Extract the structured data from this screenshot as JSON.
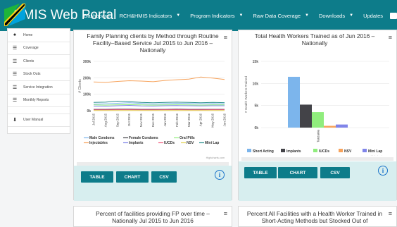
{
  "brand": {
    "title": "HMIS Web Portal"
  },
  "nav": {
    "items": [
      "Dashboard",
      "RCH&HMIS Indicators",
      "Program Indicators",
      "Raw Data Coverage",
      "Downloads",
      "Updates"
    ]
  },
  "sidebar": {
    "items": [
      {
        "label": "Home",
        "icon": "home-icon"
      },
      {
        "label": "Coverage",
        "icon": "list-icon"
      },
      {
        "label": "Clients",
        "icon": "list-icon"
      },
      {
        "label": "Stock Outs",
        "icon": "list-icon"
      },
      {
        "label": "Service Integration",
        "icon": "list-icon"
      },
      {
        "label": "Monthly Reports",
        "icon": "list-icon"
      },
      {
        "label": "User Manual",
        "icon": "download-icon"
      }
    ]
  },
  "buttons": {
    "table": "TABLE",
    "chart": "CHART",
    "csv": "CSV"
  },
  "credit": "Highcharts.com",
  "panels": {
    "p3_title": "Percent of facilities providing FP over time – Nationally Jul 2015 to Jun 2016",
    "p4_title": "Percent All Facilities with a Health Worker Trained in Short-Acting Methods but Stocked Out of"
  },
  "chart_data": [
    {
      "type": "line",
      "title": "Family Planning clients by Method through Routine Facility–Based Service Jul 2015 to Jun 2016 – Nationally",
      "ylabel": "# Clients",
      "ylim": [
        0,
        300000
      ],
      "yticks": [
        "300k",
        "200k",
        "100k",
        "0k"
      ],
      "x": [
        "Jul 2015",
        "Aug 2015",
        "Sep 2015",
        "Oct 2015",
        "Nov 2015",
        "Dec 2015",
        "Jan 2016",
        "Feb 2016",
        "Mar 2016",
        "Apr 2016",
        "May 2016",
        "Jun 2016"
      ],
      "series": [
        {
          "name": "Male Condoms",
          "color": "#7cb5ec",
          "values": [
            40000,
            42000,
            45000,
            48000,
            44000,
            40000,
            43000,
            45000,
            44000,
            42000,
            43000,
            42000
          ]
        },
        {
          "name": "Female Condoms",
          "color": "#434348",
          "values": [
            8000,
            8000,
            9000,
            9000,
            8000,
            8000,
            8000,
            9000,
            8000,
            8000,
            8000,
            8000
          ]
        },
        {
          "name": "Oral Pills",
          "color": "#90ed7d",
          "values": [
            35000,
            34000,
            36000,
            37000,
            35000,
            34000,
            35000,
            36000,
            35000,
            34000,
            35000,
            35000
          ]
        },
        {
          "name": "Injectables",
          "color": "#f7a35c",
          "values": [
            175000,
            172000,
            178000,
            182000,
            180000,
            176000,
            184000,
            188000,
            192000,
            205000,
            198000,
            190000
          ]
        },
        {
          "name": "Implants",
          "color": "#8085e9",
          "values": [
            28000,
            27000,
            30000,
            32000,
            29000,
            28000,
            30000,
            31000,
            30000,
            29000,
            30000,
            30000
          ]
        },
        {
          "name": "IUCDs",
          "color": "#f15c80",
          "values": [
            5000,
            5000,
            6000,
            6000,
            5000,
            5000,
            6000,
            6000,
            5000,
            5000,
            6000,
            6000
          ]
        },
        {
          "name": "NSV",
          "color": "#e4d354",
          "values": [
            1000,
            1000,
            1000,
            1000,
            1000,
            1000,
            1000,
            1000,
            1000,
            1000,
            1000,
            1000
          ]
        },
        {
          "name": "Mini Lap",
          "color": "#2b908f",
          "values": [
            50000,
            52000,
            58000,
            55000,
            50000,
            48000,
            50000,
            52000,
            50000,
            48000,
            50000,
            49000
          ]
        }
      ]
    },
    {
      "type": "bar",
      "title": "Total Health Workers Trained as of Jun 2016 – Nationally",
      "ylabel": "# Health Workers Trained",
      "ylim": [
        0,
        15000
      ],
      "yticks": [
        "15k",
        "10k",
        "5k",
        "0k"
      ],
      "categories": [
        "Short Acting",
        "Implants",
        "IUCDs",
        "NSV",
        "Mini Lap"
      ],
      "colors": [
        "#7cb5ec",
        "#434348",
        "#90ed7d",
        "#f7a35c",
        "#8085e9"
      ],
      "values": [
        11500,
        5200,
        3500,
        400,
        700
      ],
      "xlabel": "Tanzania"
    }
  ]
}
